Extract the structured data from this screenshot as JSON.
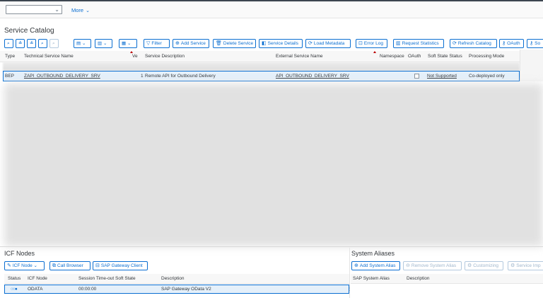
{
  "topbar": {
    "select_value": "",
    "more_label": "More"
  },
  "catalog": {
    "title": "Service Catalog",
    "toolbar": {
      "filter": "Filter",
      "add_service": "Add Service",
      "delete_service": "Delete Service",
      "service_details": "Service Details",
      "load_metadata": "Load Metadata",
      "error_log": "Error Log",
      "request_statistics": "Request Statistics",
      "refresh_catalog": "Refresh Catalog",
      "oauth": "OAuth",
      "so": "So"
    },
    "columns": {
      "type": "Type",
      "technical_service_name": "Technical Service Name",
      "version": "Ve",
      "service_description": "Service Description",
      "external_service_name": "External Service Name",
      "namespace": "Namespace",
      "oauth": "OAuth",
      "soft_state_status": "Soft State Status",
      "processing_mode": "Processing Mode"
    },
    "rows": [
      {
        "type": "BEP",
        "technical_service_name": "ZAPI_OUTBOUND_DELIVERY_SRV",
        "version": "1",
        "service_description": "Remote API for Outbound Delivery",
        "external_service_name": "API_OUTBOUND_DELIVERY_SRV",
        "namespace": "",
        "soft_state_status": "Not Supported",
        "processing_mode": "Co-deployed only"
      }
    ]
  },
  "icf": {
    "title": "ICF Nodes",
    "toolbar": {
      "icf_node": "ICF Node",
      "call_browser": "Call Browser",
      "sap_gateway_client": "SAP Gateway Client"
    },
    "columns": {
      "status": "Status",
      "icf_node": "ICF Node",
      "session_timeout": "Session Time-out Soft State",
      "description": "Description"
    },
    "rows": [
      {
        "status_icon": "status-icon",
        "icf_node": "ODATA",
        "session_timeout": "00:00:00",
        "description": "SAP Gateway OData V2"
      }
    ]
  },
  "aliases": {
    "title": "System Aliases",
    "toolbar": {
      "add_system_alias": "Add System Alias",
      "remove_system_alias": "Remove System Alias",
      "customizing": "Customizing",
      "service_imp": "Service Imp"
    },
    "columns": {
      "sap_system_alias": "SAP System Alias",
      "description": "Description"
    }
  },
  "colors": {
    "accent": "#0a6ed1",
    "selected_row": "#e5f0fa",
    "sort_marker": "#bb0000"
  }
}
